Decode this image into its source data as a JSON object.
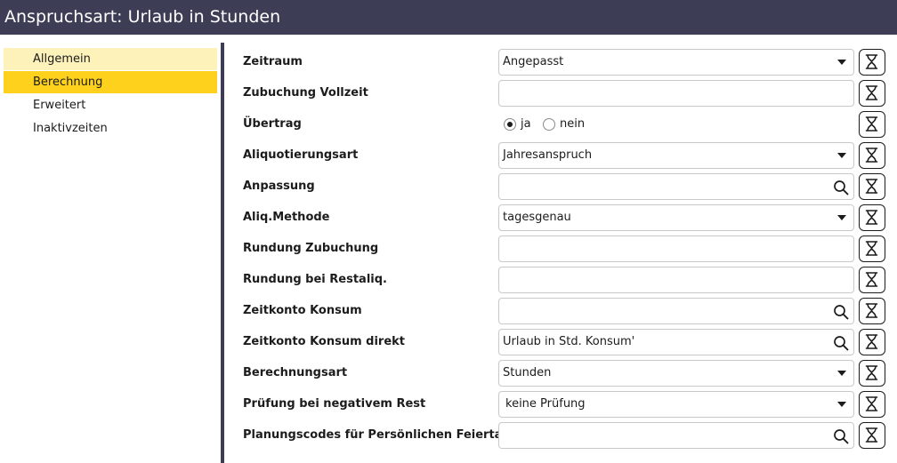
{
  "header": {
    "title": "Anspruchsart: Urlaub in Stunden"
  },
  "sidebar": {
    "items": [
      {
        "label": "Allgemein"
      },
      {
        "label": "Berechnung"
      },
      {
        "label": "Erweitert"
      },
      {
        "label": "Inaktivzeiten"
      }
    ]
  },
  "form": {
    "zeitraum": {
      "label": "Zeitraum",
      "value": "Angepasst"
    },
    "zubuchung_vollzeit": {
      "label": "Zubuchung Vollzeit",
      "value": ""
    },
    "uebertrag": {
      "label": "Übertrag",
      "options": [
        "ja",
        "nein"
      ],
      "selected": "ja"
    },
    "aliquotierungsart": {
      "label": "Aliquotierungsart",
      "value": "Jahresanspruch"
    },
    "anpassung": {
      "label": "Anpassung",
      "value": ""
    },
    "aliq_methode": {
      "label": "Aliq.Methode",
      "value": "tagesgenau"
    },
    "rundung_zubuchung": {
      "label": "Rundung Zubuchung",
      "value": ""
    },
    "rundung_restaliq": {
      "label": "Rundung bei Restaliq.",
      "value": ""
    },
    "zeitkonto_konsum": {
      "label": "Zeitkonto Konsum",
      "value": ""
    },
    "zeitkonto_konsum_direkt": {
      "label": "Zeitkonto Konsum direkt",
      "value": "Urlaub in Std. Konsum'"
    },
    "berechnungsart": {
      "label": "Berechnungsart",
      "value": "Stunden"
    },
    "pruefung_negativ": {
      "label": "Prüfung bei negativem Rest",
      "value": "keine Prüfung"
    },
    "planungscodes": {
      "label": "Planungscodes für Persönlichen Feiertag",
      "value": ""
    }
  },
  "icons": {
    "dropdown": "chevron-down-icon",
    "search": "search-icon",
    "history": "hourglass-icon"
  },
  "colors": {
    "header_bg": "#3d3d56",
    "nav_active": "#fed21c",
    "nav_light": "#fdf2b9"
  }
}
